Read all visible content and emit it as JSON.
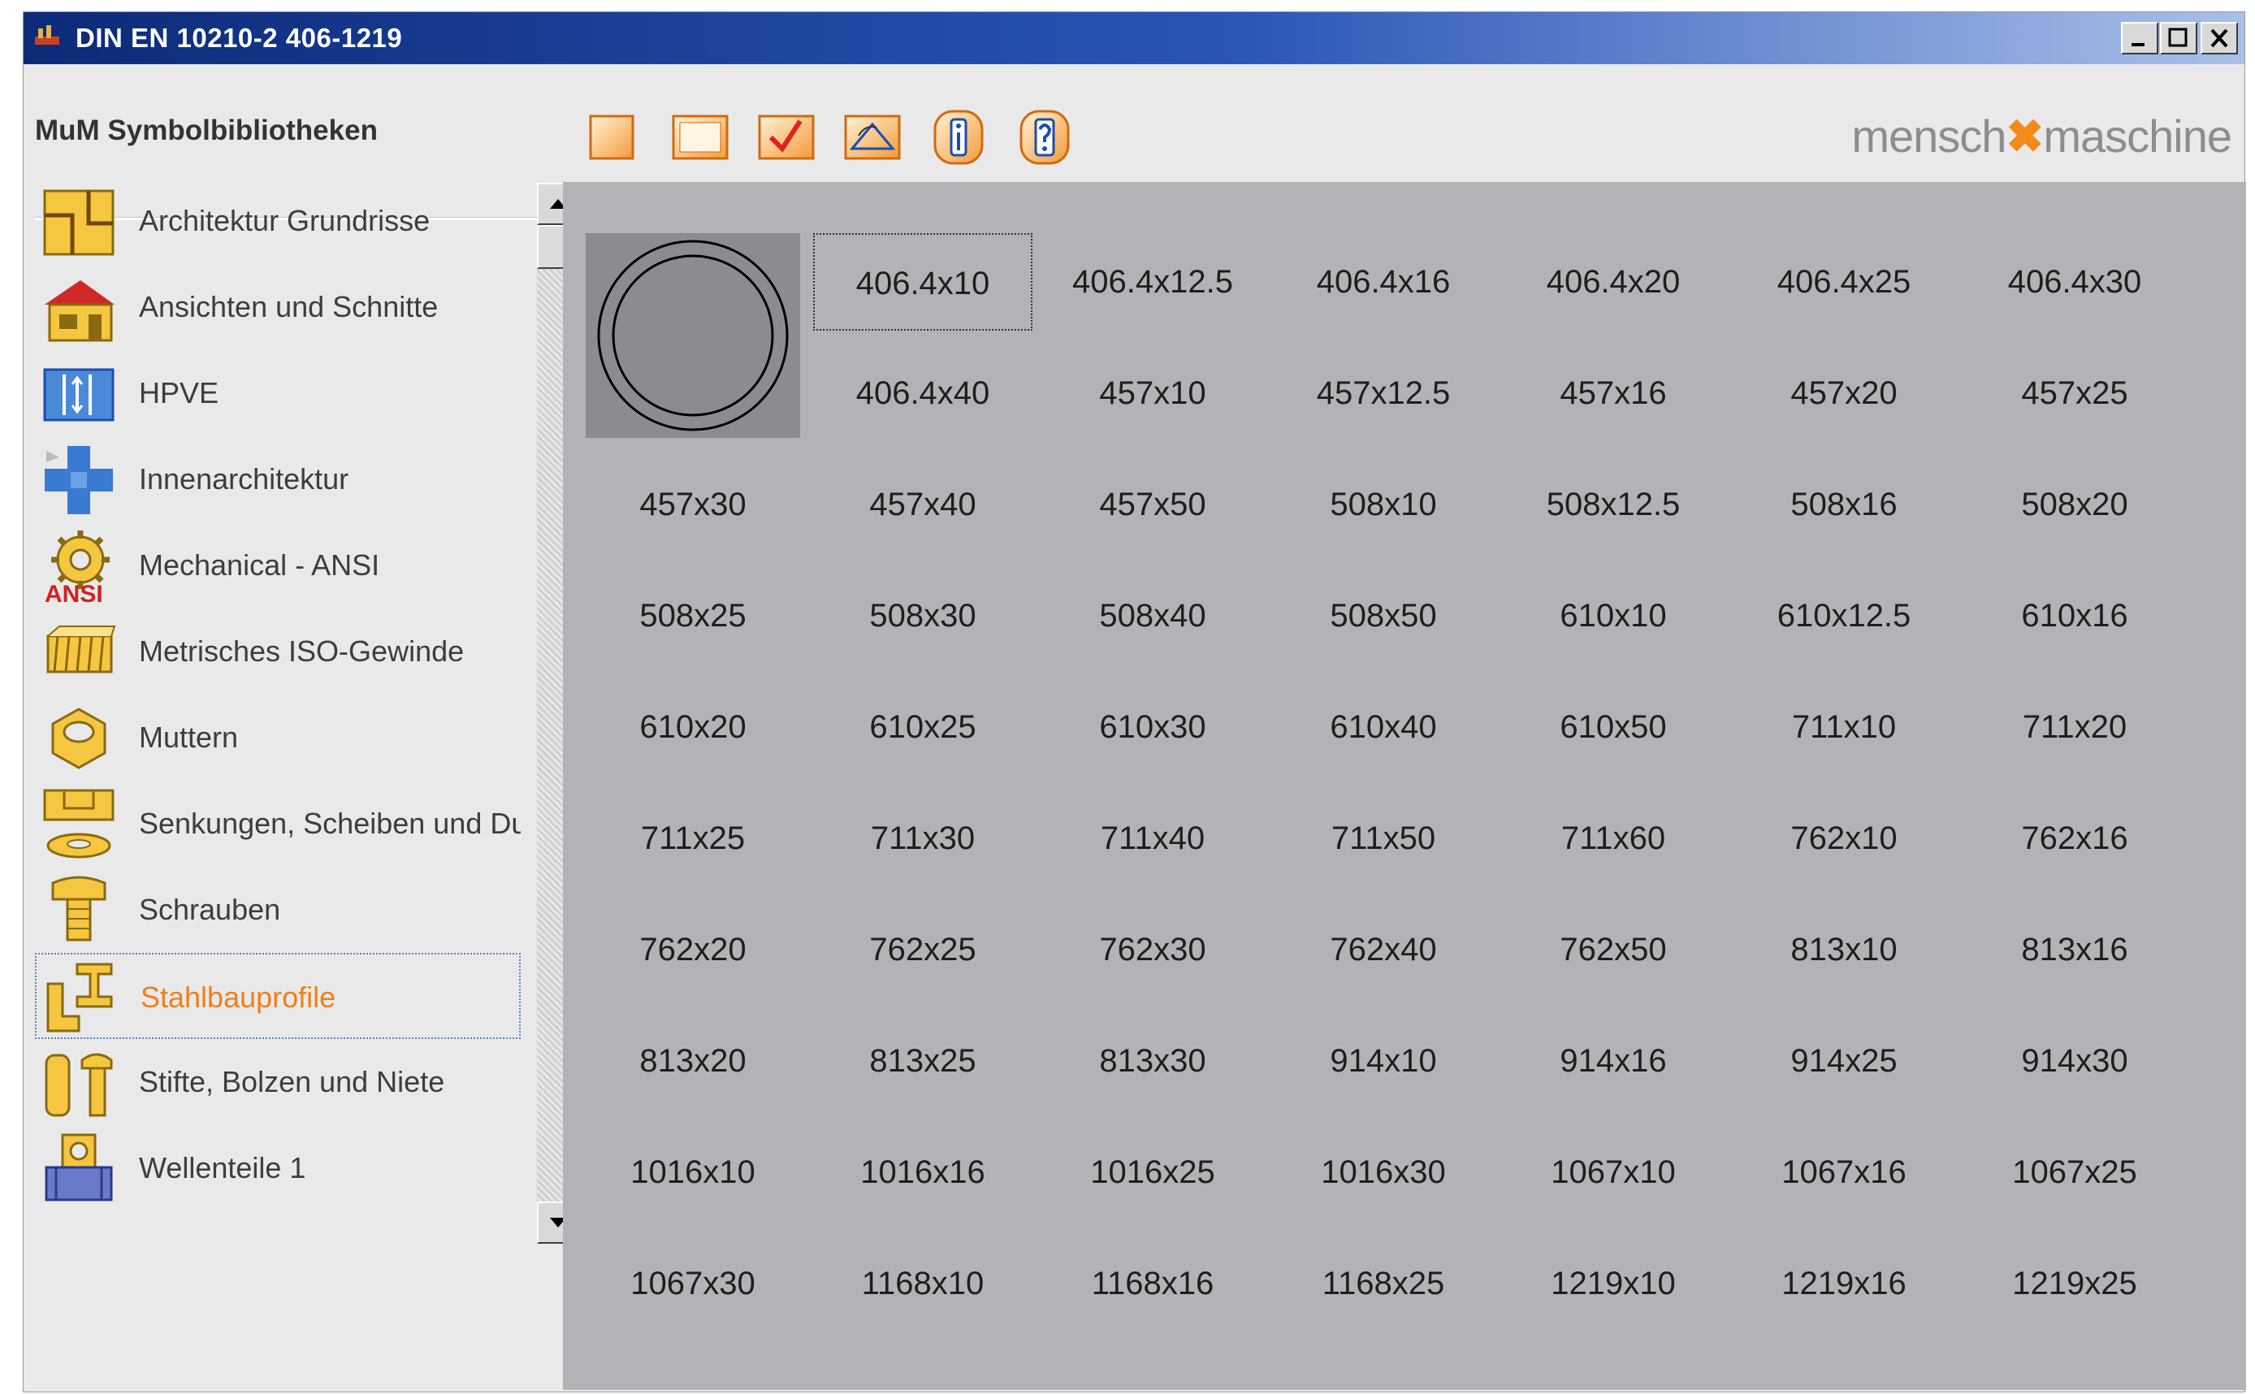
{
  "window": {
    "title": "DIN EN 10210-2 406-1219",
    "buttons": [
      "minimize",
      "maximize",
      "close"
    ]
  },
  "header": {
    "app_name": "MuM Symbolbibliotheken",
    "brand": {
      "left": "mensch",
      "right": "maschine"
    },
    "toolbar": [
      {
        "icon": "blank-page-icon"
      },
      {
        "icon": "page-frame-icon"
      },
      {
        "icon": "checkmark-icon"
      },
      {
        "icon": "rotate-symbol-icon"
      },
      {
        "icon": "info-icon"
      },
      {
        "icon": "help-icon"
      }
    ]
  },
  "sidebar": {
    "items": [
      {
        "label": "Architektur Grundrisse",
        "icon": "floor-plan-icon"
      },
      {
        "label": "Ansichten und Schnitte",
        "icon": "house-icon"
      },
      {
        "label": "HPVE",
        "icon": "hpve-icon"
      },
      {
        "label": "Innenarchitektur",
        "icon": "furniture-icon"
      },
      {
        "label": "Mechanical - ANSI",
        "icon": "gear-ansi-icon"
      },
      {
        "label": "Metrisches ISO-Gewinde",
        "icon": "thread-icon"
      },
      {
        "label": "Muttern",
        "icon": "nut-icon"
      },
      {
        "label": "Senkungen, Scheiben und Du",
        "icon": "washer-icon"
      },
      {
        "label": "Schrauben",
        "icon": "screw-icon"
      },
      {
        "label": "Stahlbauprofile",
        "icon": "steel-profile-icon",
        "selected": true
      },
      {
        "label": "Stifte, Bolzen und Niete",
        "icon": "pin-icon"
      },
      {
        "label": "Wellenteile 1",
        "icon": "shaft-icon"
      }
    ]
  },
  "grid": {
    "selected": "406.4x10",
    "items": [
      "406.4x10",
      "406.4x12.5",
      "406.4x16",
      "406.4x20",
      "406.4x25",
      "406.4x30",
      "406.4x40",
      "457x10",
      "457x12.5",
      "457x16",
      "457x20",
      "457x25",
      "457x30",
      "457x40",
      "457x50",
      "508x10",
      "508x12.5",
      "508x16",
      "508x20",
      "508x25",
      "508x30",
      "508x40",
      "508x50",
      "610x10",
      "610x12.5",
      "610x16",
      "610x20",
      "610x25",
      "610x30",
      "610x40",
      "610x50",
      "711x10",
      "711x20",
      "711x25",
      "711x30",
      "711x40",
      "711x50",
      "711x60",
      "762x10",
      "762x16",
      "762x20",
      "762x25",
      "762x30",
      "762x40",
      "762x50",
      "813x10",
      "813x16",
      "813x20",
      "813x25",
      "813x30",
      "914x10",
      "914x16",
      "914x25",
      "914x30",
      "1016x10",
      "1016x16",
      "1016x25",
      "1016x30",
      "1067x10",
      "1067x16",
      "1067x25",
      "1067x30",
      "1168x10",
      "1168x16",
      "1168x25",
      "1219x10",
      "1219x16",
      "1219x25"
    ]
  },
  "colors": {
    "accent": "#f07f1a",
    "titlebar": "#0c2a78",
    "panel": "#b1b3b7"
  }
}
